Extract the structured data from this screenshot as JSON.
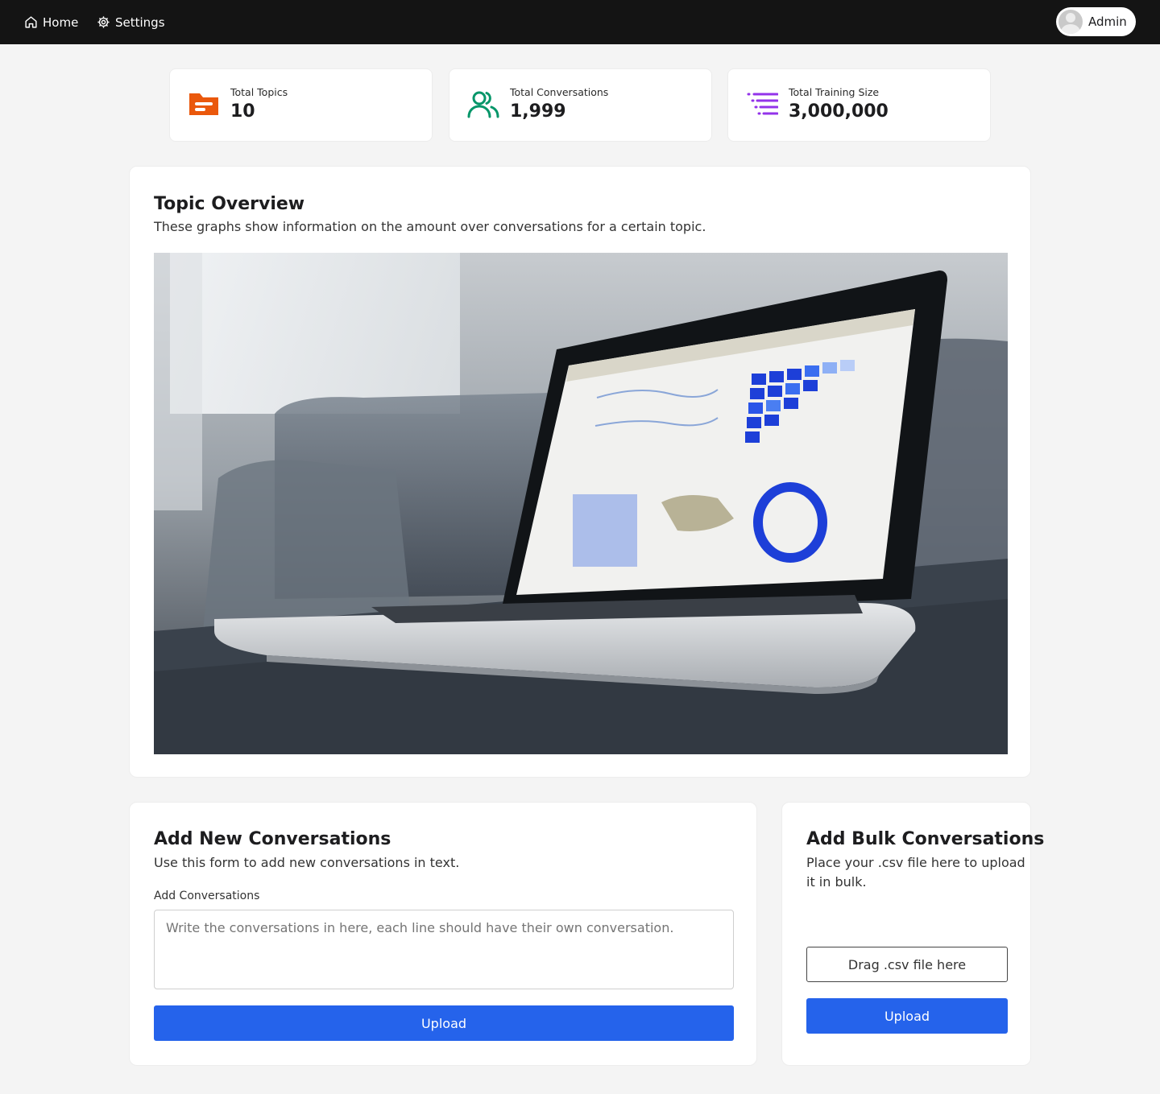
{
  "nav": {
    "home_label": "Home",
    "settings_label": "Settings",
    "user_name": "Admin"
  },
  "stats": [
    {
      "label": "Total Topics",
      "value": "10",
      "icon": "folder-icon",
      "color": "#ea580c"
    },
    {
      "label": "Total Conversations",
      "value": "1,999",
      "icon": "users-icon",
      "color": "#059669"
    },
    {
      "label": "Total Training Size",
      "value": "3,000,000",
      "icon": "list-icon",
      "color": "#9333ea"
    }
  ],
  "overview": {
    "title": "Topic Overview",
    "description": "These graphs show information on the amount over conversations for a certain topic.",
    "image": "laptop-analytics-photo"
  },
  "add_conversations": {
    "title": "Add New Conversations",
    "description": "Use this form to add new conversations in text.",
    "field_label": "Add Conversations",
    "textarea_placeholder": "Write the conversations in here, each line should have their own conversation.",
    "upload_label": "Upload"
  },
  "bulk": {
    "title": "Add Bulk Conversations",
    "description": "Place your .csv file here to upload it in bulk.",
    "dropzone_label": "Drag .csv file here",
    "upload_label": "Upload"
  },
  "colors": {
    "nav_bg": "#141414",
    "accent": "#2563eb",
    "page_bg": "#f4f4f4"
  }
}
